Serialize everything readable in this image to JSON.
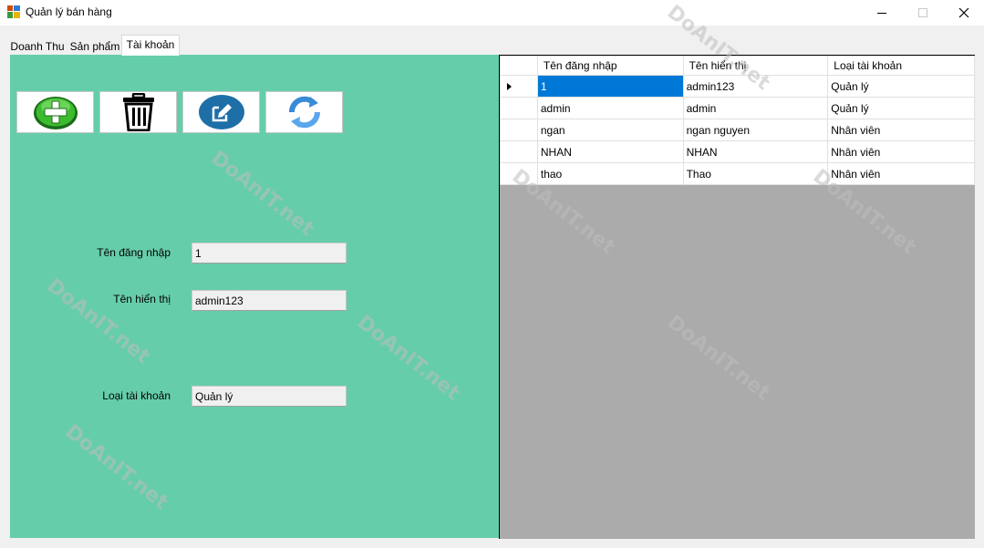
{
  "window": {
    "title": "Quản lý bán hàng"
  },
  "tabs": [
    {
      "label": "Doanh Thu"
    },
    {
      "label": "Sản phẩm"
    },
    {
      "label": "Tài khoản"
    }
  ],
  "toolbar": {
    "add_icon": "add-plus-icon",
    "delete_icon": "trash-icon",
    "edit_icon": "edit-pencil-icon",
    "refresh_icon": "refresh-icon"
  },
  "form": {
    "username_label": "Tên đăng nhập",
    "username_value": "1",
    "displayname_label": "Tên hiển thị",
    "displayname_value": "admin123",
    "accounttype_label": "Loại tài khoản",
    "accounttype_value": "Quản lý"
  },
  "grid": {
    "columns": [
      "Tên đăng nhập",
      "Tên hiển thị",
      "Loại tài khoản"
    ],
    "rows": [
      [
        "1",
        "admin123",
        "Quản lý"
      ],
      [
        "admin",
        "admin",
        "Quản lý"
      ],
      [
        "ngan",
        "ngan nguyen",
        "Nhân viên"
      ],
      [
        "NHAN",
        "NHAN",
        "Nhân viên"
      ],
      [
        "thao",
        "Thao",
        "Nhân viên"
      ]
    ]
  },
  "watermark": {
    "text": "DoAnIT.net"
  },
  "colors": {
    "panel": "#66cdaa",
    "grid_background": "#ababab",
    "selection": "#0078d7"
  }
}
